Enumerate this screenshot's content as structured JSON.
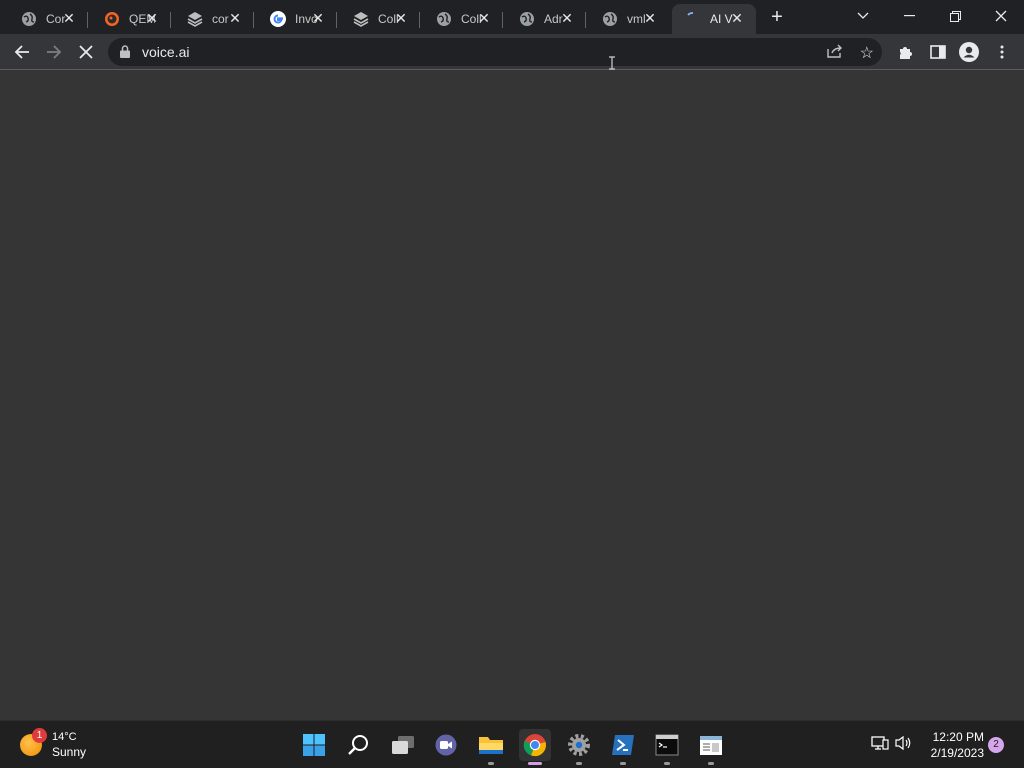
{
  "browser": {
    "tabs": [
      {
        "title": "Cor",
        "icon": "globe-icon"
      },
      {
        "title": "QEM",
        "icon": "qemu-icon"
      },
      {
        "title": "cor",
        "icon": "project-icon"
      },
      {
        "title": "Invo",
        "icon": "google-icon"
      },
      {
        "title": "Coll",
        "icon": "project-icon"
      },
      {
        "title": "Coll",
        "icon": "globe-icon"
      },
      {
        "title": "Adr",
        "icon": "globe-icon"
      },
      {
        "title": "vml",
        "icon": "globe-icon"
      },
      {
        "title": "AI V",
        "icon": "loading-icon",
        "active": true
      }
    ],
    "url": "voice.ai"
  },
  "taskbar": {
    "weather": {
      "temp": "14°C",
      "condition": "Sunny",
      "badge": "1"
    },
    "apps": [
      "start",
      "search",
      "task-view",
      "teams",
      "file-explorer",
      "chrome",
      "settings",
      "powershell",
      "terminal",
      "notepad"
    ],
    "clock": {
      "time": "12:20 PM",
      "date": "2/19/2023"
    },
    "notifications": "2"
  },
  "colors": {
    "tabstrip": "#202124",
    "toolbar": "#35363a",
    "content": "#353535",
    "taskbar": "#202020"
  }
}
